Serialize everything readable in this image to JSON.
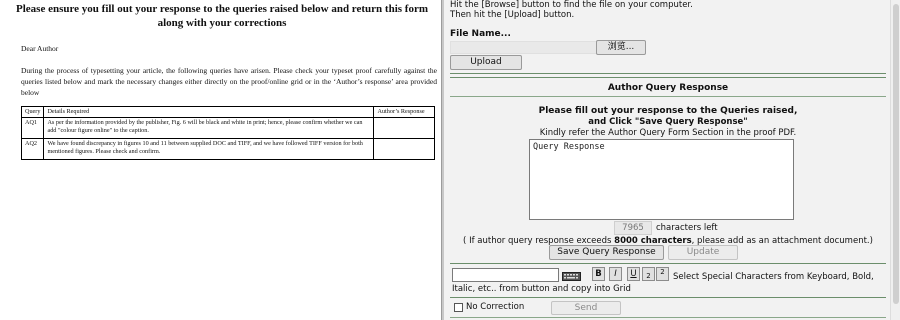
{
  "form": {
    "heading": "Please ensure you fill out your response to the queries raised below and return this form along with your corrections",
    "salutation": "Dear Author",
    "intro": "During the process of typesetting your article, the following queries have arisen. Please check your typeset proof carefully against the queries listed below and mark the necessary changes either directly on the proof/online grid or in the ‘Author’s response’ area provided below",
    "table": {
      "headers": [
        "Query",
        "Details Required",
        "Author’s Response"
      ],
      "rows": [
        {
          "query": "AQ1",
          "details": "As per the information provided by the publisher, Fig. 6 will be black and white in print; hence, please confirm whether we can add \"colour figure online\" to the caption.",
          "response": ""
        },
        {
          "query": "AQ2",
          "details": "We have found discrepancy in figures 10 and 11 between supplied DOC and TIFF, and we have followed TIFF version for both mentioned figures. Please check and confirm.",
          "response": ""
        }
      ]
    }
  },
  "panel": {
    "instruction_line1": "Hit the [Browse] button to find the file on your computer.",
    "instruction_line2": "Then hit the [Upload] button.",
    "file_name_label": "File Name...",
    "browse_label": "浏览...",
    "upload_label": "Upload",
    "section_title": "Author Query Response",
    "prompt_line1": "Please fill out your response to the Queries raised,",
    "prompt_line2": "and Click \"Save Query Response\"",
    "prompt_line3": "Kindly refer the Author Query Form Section in the proof PDF.",
    "response_placeholder": "Query Response",
    "chars_remaining": "7965",
    "chars_left_label": "characters left",
    "limit_note_prefix": "( If author query response exceeds ",
    "limit_note_bold": "8000 characters",
    "limit_note_suffix": ", please add as an attachment document.)",
    "save_label": "Save Query Response",
    "update_label": "Update",
    "format_buttons": {
      "bold": "B",
      "italic": "I",
      "underline": "U",
      "subscript": "2",
      "superscript": "2"
    },
    "special_chars_line1": "Select Special Characters from Keyboard, Bold,",
    "special_chars_line2": "Italic, etc.. from button and copy into Grid",
    "no_correction_label": "No Correction",
    "send_label": "Send"
  },
  "icons": {
    "keyboard": "keyboard-icon",
    "checkbox": "checkbox-unchecked"
  },
  "colors": {
    "panel_bg": "#f2f2f2",
    "divider_green": "#6b8e6b"
  }
}
